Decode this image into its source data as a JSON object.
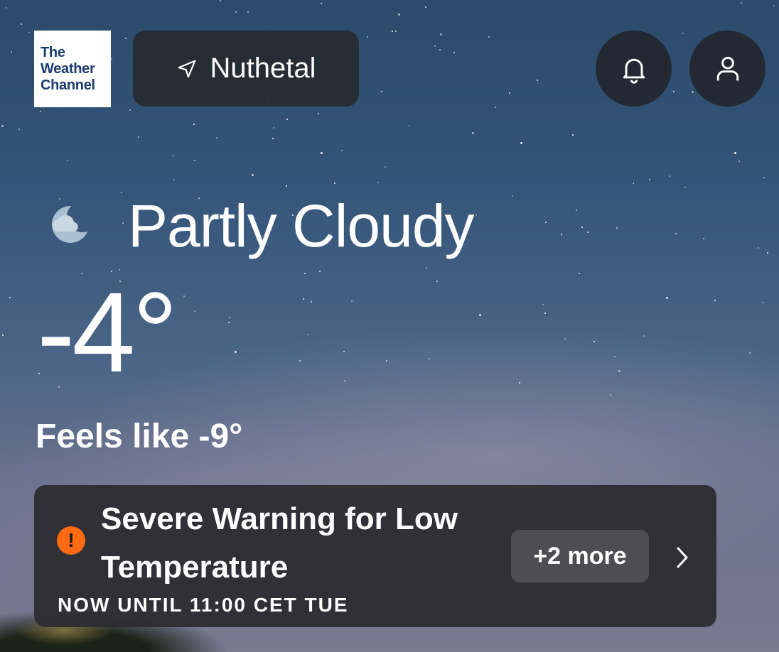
{
  "brand": {
    "logo_lines": [
      "The",
      "Weather",
      "Channel"
    ],
    "logo_color": "#1b3c6e"
  },
  "header": {
    "location": "Nuthetal",
    "location_icon": "navigation-arrow-icon",
    "bell_icon": "bell-icon",
    "profile_icon": "user-icon"
  },
  "current": {
    "condition": "Partly Cloudy",
    "condition_icon": "moon-cloud-icon",
    "temperature": "-4°",
    "feels_like": "Feels like -9°"
  },
  "alert": {
    "title": "Severe Warning for Low Temperature",
    "time": "NOW UNTIL 11:00 CET TUE",
    "more_label": "+2 more",
    "severity_color": "#ff6a13",
    "icon": "alert-exclamation-icon"
  }
}
